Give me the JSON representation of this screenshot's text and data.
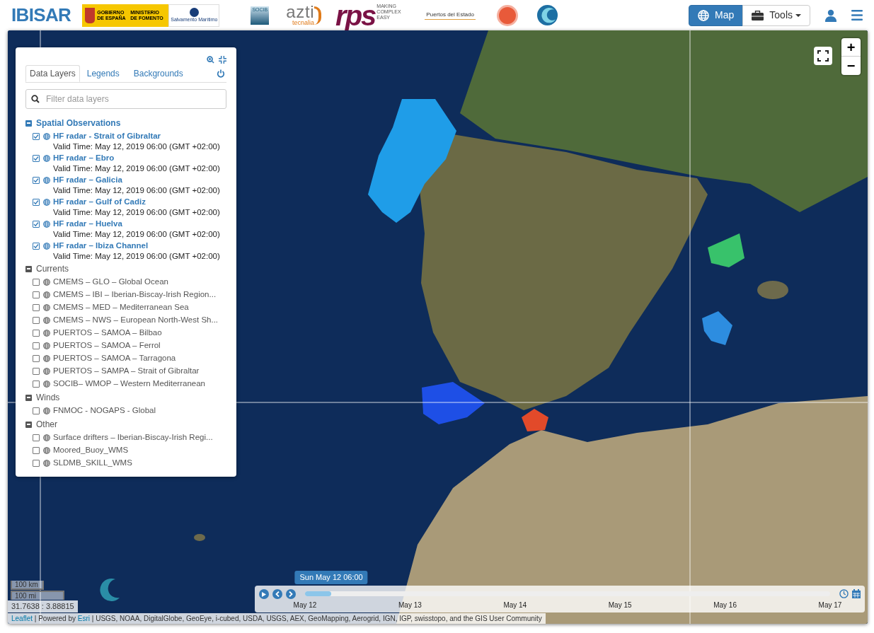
{
  "header": {
    "brand": "IBISAR",
    "logos": [
      {
        "kind": "gobierno",
        "texts": [
          "GOBIERNO DE ESPAÑA",
          "MINISTERIO DE FOMENTO",
          "Salvamento Marítimo"
        ]
      },
      {
        "kind": "socib",
        "texts": [
          "SOCIB"
        ]
      },
      {
        "kind": "azti",
        "texts": [
          "azti",
          "tecnalia"
        ]
      },
      {
        "kind": "rps",
        "texts": [
          "rps",
          "MAKING COMPLEX EASY"
        ]
      },
      {
        "kind": "puertos",
        "texts": [
          "Puertos del Estado"
        ]
      },
      {
        "kind": "seal"
      },
      {
        "kind": "wave"
      }
    ],
    "nav": [
      {
        "kind": "map",
        "label": "Map",
        "selected": true
      },
      {
        "kind": "tools",
        "label": "Tools",
        "selected": false
      }
    ]
  },
  "panel": {
    "tabs": [
      {
        "label": "Data Layers",
        "selected": true
      },
      {
        "label": "Legends",
        "selected": false
      },
      {
        "label": "Backgrounds",
        "selected": false
      }
    ],
    "search": {
      "placeholder": "Filter data layers"
    },
    "groups": [
      {
        "label": "Spatial Observations",
        "expanded": true,
        "layers": [
          {
            "label": "HF radar - Strait of Gibraltar",
            "checked": true,
            "valid_time": "Valid Time: May 12, 2019 06:00 (GMT +02:00)"
          },
          {
            "label": "HF radar – Ebro",
            "checked": true,
            "valid_time": "Valid Time: May 12, 2019 06:00 (GMT +02:00)"
          },
          {
            "label": "HF radar – Galicia",
            "checked": true,
            "valid_time": "Valid Time: May 12, 2019 06:00 (GMT +02:00)"
          },
          {
            "label": "HF radar – Gulf of Cadiz",
            "checked": true,
            "valid_time": "Valid Time: May 12, 2019 06:00 (GMT +02:00)"
          },
          {
            "label": "HF radar – Huelva",
            "checked": true,
            "valid_time": "Valid Time: May 12, 2019 06:00 (GMT +02:00)"
          },
          {
            "label": "HF radar – Ibiza Channel",
            "checked": true,
            "valid_time": "Valid Time: May 12, 2019 06:00 (GMT +02:00)"
          }
        ]
      },
      {
        "label": "Currents",
        "expanded": true,
        "layers": [
          {
            "label": "CMEMS – GLO – Global Ocean",
            "checked": false
          },
          {
            "label": "CMEMS – IBI – Iberian-Biscay-Irish Region...",
            "checked": false
          },
          {
            "label": "CMEMS – MED – Mediterranean Sea",
            "checked": false
          },
          {
            "label": "CMEMS – NWS – European North-West Sh...",
            "checked": false
          },
          {
            "label": "PUERTOS – SAMOA – Bilbao",
            "checked": false
          },
          {
            "label": "PUERTOS – SAMOA – Ferrol",
            "checked": false
          },
          {
            "label": "PUERTOS – SAMOA – Tarragona",
            "checked": false
          },
          {
            "label": "PUERTOS – SAMPA – Strait of Gibraltar",
            "checked": false
          },
          {
            "label": "SOCIB– WMOP – Western Mediterranean",
            "checked": false
          }
        ]
      },
      {
        "label": "Winds",
        "expanded": true,
        "layers": [
          {
            "label": "FNMOC - NOGAPS - Global",
            "checked": false
          }
        ]
      },
      {
        "label": "Other",
        "expanded": true,
        "layers": [
          {
            "label": "Surface drifters – Iberian-Biscay-Irish Regi...",
            "checked": false
          },
          {
            "label": "Moored_Buoy_WMS",
            "checked": false
          },
          {
            "label": "SLDMB_SKILL_WMS",
            "checked": false
          }
        ]
      }
    ]
  },
  "map": {
    "zoom_in": "+",
    "zoom_out": "−",
    "scale": [
      "100 km",
      "100 mi"
    ],
    "coordinates": "31.7638 : 3.88815",
    "attribution": [
      {
        "text": "Leaflet",
        "link": true
      },
      {
        "text": " | Powered by ",
        "link": false
      },
      {
        "text": "Esri",
        "link": true
      },
      {
        "text": " | USGS, NOAA, DigitalGlobe, GeoEye, i-cubed, USDA, USGS, AEX, GeoMapping, Aerogrid, IGN, IGP, swisstopo, and the GIS User Community",
        "link": false
      }
    ]
  },
  "timeline": {
    "current": "Sun May 12 06:00",
    "level": 0.05,
    "ticks": [
      "May 12",
      "May 13",
      "May 14",
      "May 15",
      "May 16",
      "May 17"
    ]
  }
}
